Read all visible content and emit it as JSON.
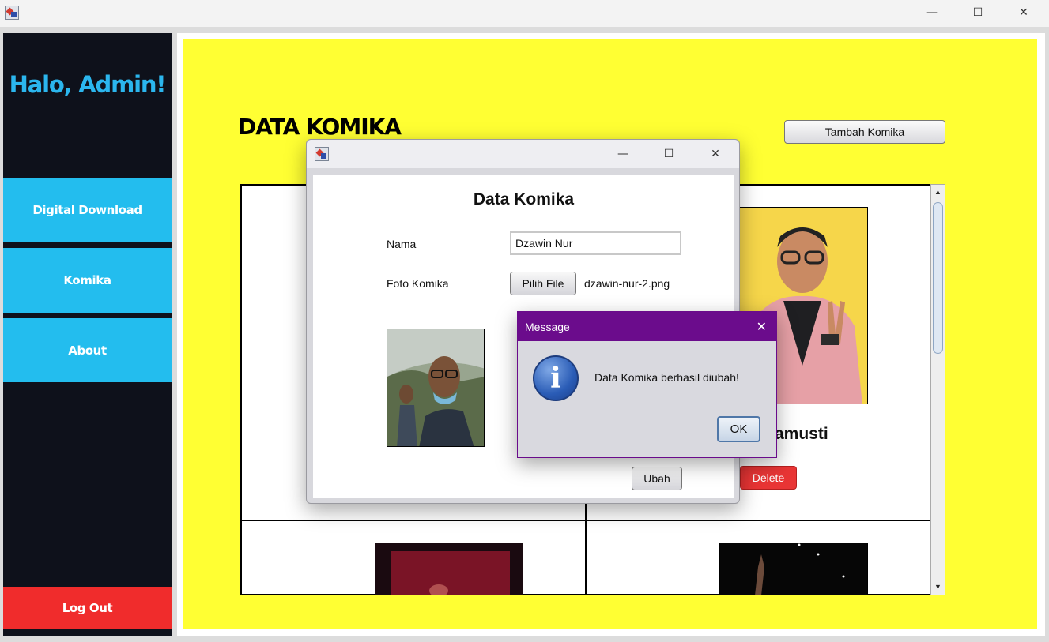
{
  "window": {
    "minimize": "—",
    "maximize": "☐",
    "close": "✕"
  },
  "sidebar": {
    "greeting": "Halo, Admin!",
    "items": [
      {
        "label": "Digital Download"
      },
      {
        "label": "Komika"
      },
      {
        "label": "About"
      }
    ],
    "logout": "Log Out"
  },
  "main": {
    "title": "DATA KOMIKA",
    "add_button": "Tambah Komika",
    "card": {
      "name_partial": "amusti",
      "delete_button": "Delete"
    }
  },
  "data_dialog": {
    "heading": "Data Komika",
    "name_label": "Nama",
    "name_value": "Dzawin Nur",
    "photo_label": "Foto Komika",
    "choose_file_button": "Pilih File",
    "file_name": "dzawin-nur-2.png",
    "update_button": "Ubah"
  },
  "message_dialog": {
    "title": "Message",
    "text": "Data Komika berhasil diubah!",
    "ok_button": "OK",
    "icon": "information-icon"
  },
  "colors": {
    "sidebar_bg": "#0e111b",
    "nav_bg": "#23bdee",
    "greeting": "#2bb6ee",
    "logout_bg": "#f02c2c",
    "content_bg": "#ffff33",
    "delete_bg": "#e93535",
    "message_title_bg": "#6b0c8c"
  }
}
